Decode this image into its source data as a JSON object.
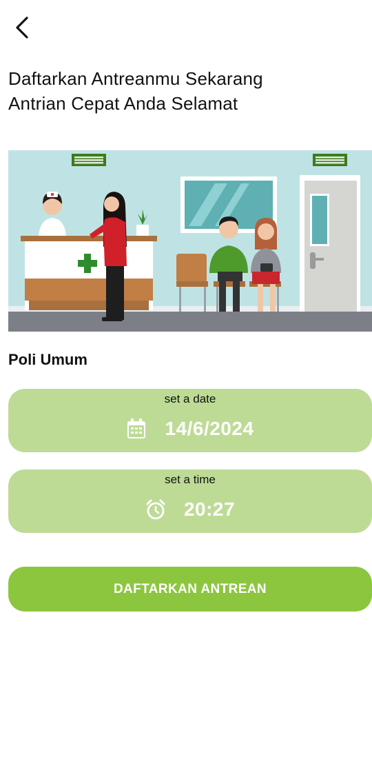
{
  "header": {
    "back_icon": "chevron-left-icon"
  },
  "headline": {
    "line1": "Daftarkan Antreanmu Sekarang",
    "line2": "Antrian Cepat Anda Selamat"
  },
  "illustration": {
    "sign_cross_color": "#2e8b2e",
    "sky_color": "#bfe3e4"
  },
  "section": {
    "title": "Poli Umum"
  },
  "date_picker": {
    "caption": "set a date",
    "value": "14/6/2024",
    "icon": "calendar-icon"
  },
  "time_picker": {
    "caption": "set a time",
    "value": "20:27",
    "icon": "alarm-clock-icon"
  },
  "submit": {
    "label": "DAFTARKAN ANTREAN"
  },
  "colors": {
    "picker_bg": "#bedb96",
    "button_bg": "#8cc63f",
    "value_text": "#ffffff"
  }
}
